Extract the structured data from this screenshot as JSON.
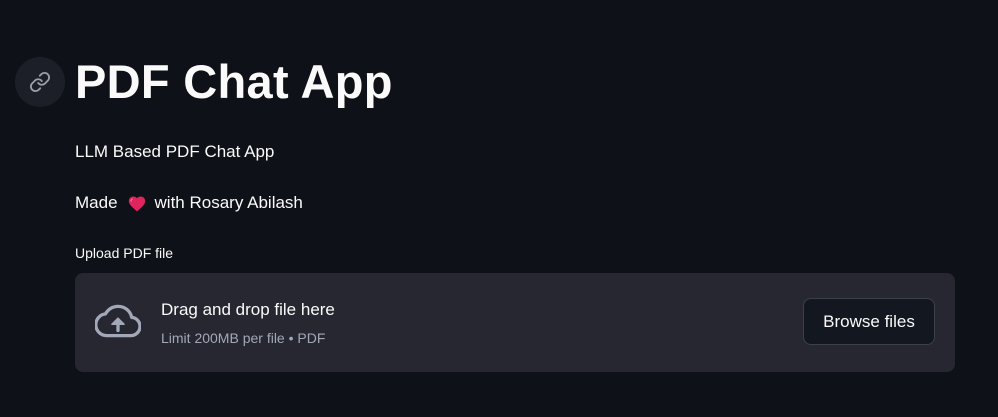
{
  "header": {
    "anchor_icon": "link-icon",
    "title": "PDF Chat App"
  },
  "intro": {
    "subtitle": "LLM Based PDF Chat App",
    "credit_prefix": "Made",
    "credit_icon": "heart-icon",
    "credit_suffix": "with Rosary Abilash"
  },
  "uploader": {
    "label": "Upload PDF file",
    "icon": "cloud-upload-icon",
    "drop_text": "Drag and drop file here",
    "limit_text": "Limit 200MB per file • PDF",
    "browse_label": "Browse files"
  },
  "colors": {
    "background": "#0e1117",
    "dropzone": "#262730",
    "heart": "#e0245e",
    "muted_text": "#a3a8b8"
  }
}
